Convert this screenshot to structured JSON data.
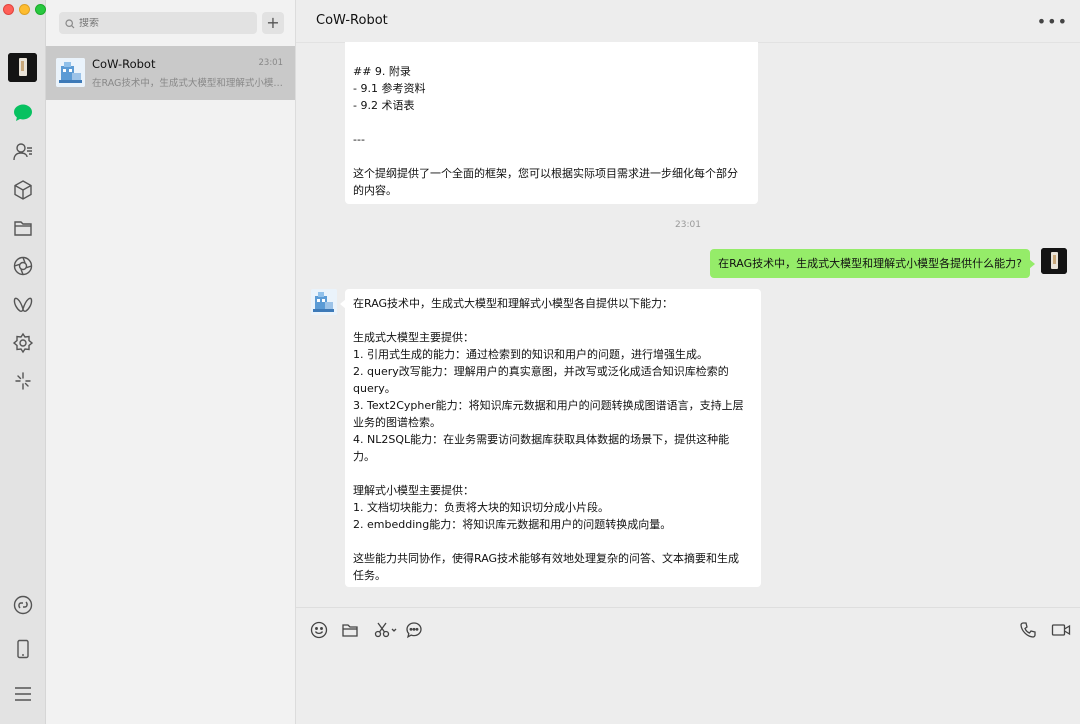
{
  "search": {
    "placeholder": "搜索"
  },
  "conversation": {
    "name": "CoW-Robot",
    "time": "23:01",
    "preview": "在RAG技术中，生成式大模型和理解式小模型各提供什么能力?"
  },
  "chat": {
    "title": "CoW-Robot",
    "prev_message_lines": [
      "## 9. 附录",
      "- 9.1 参考资料",
      "- 9.2 术语表",
      "",
      "---",
      "",
      "这个提纲提供了一个全面的框架，您可以根据实际项目需求进一步细化每个部分",
      "的内容。"
    ],
    "timestamp": "23:01",
    "user_message": "在RAG技术中，生成式大模型和理解式小模型各提供什么能力?",
    "reply_lines": [
      "在RAG技术中，生成式大模型和理解式小模型各自提供以下能力：",
      "",
      "生成式大模型主要提供：",
      "1. 引用式生成的能力：通过检索到的知识和用户的问题，进行增强生成。",
      "2. query改写能力：理解用户的真实意图，并改写或泛化成适合知识库检索的",
      "query。",
      "3. Text2Cypher能力：将知识库元数据和用户的问题转换成图谱语言，支持上层",
      "业务的图谱检索。",
      "4. NL2SQL能力：在业务需要访问数据库获取具体数据的场景下，提供这种能",
      "力。",
      "",
      "理解式小模型主要提供：",
      "1. 文档切块能力：负责将大块的知识切分成小片段。",
      "2. embedding能力：将知识库元数据和用户的问题转换成向量。",
      "",
      "这些能力共同协作，使得RAG技术能够有效地处理复杂的问答、文本摘要和生成",
      "任务。"
    ]
  },
  "icons": {
    "rail": [
      "chat-icon",
      "contacts-icon",
      "cube-icon",
      "folder-icon",
      "moments-icon",
      "channels-icon",
      "mini-program-icon",
      "sparkle-icon",
      "link-icon",
      "phone-icon",
      "menu-icon"
    ],
    "toolbar": [
      "emoji-icon",
      "folder-icon",
      "scissors-icon",
      "chat-history-icon",
      "voice-call-icon",
      "video-call-icon"
    ]
  },
  "colors": {
    "accent": "#07c160",
    "bubble_out": "#95ec69",
    "selected": "#c9c9c9"
  }
}
